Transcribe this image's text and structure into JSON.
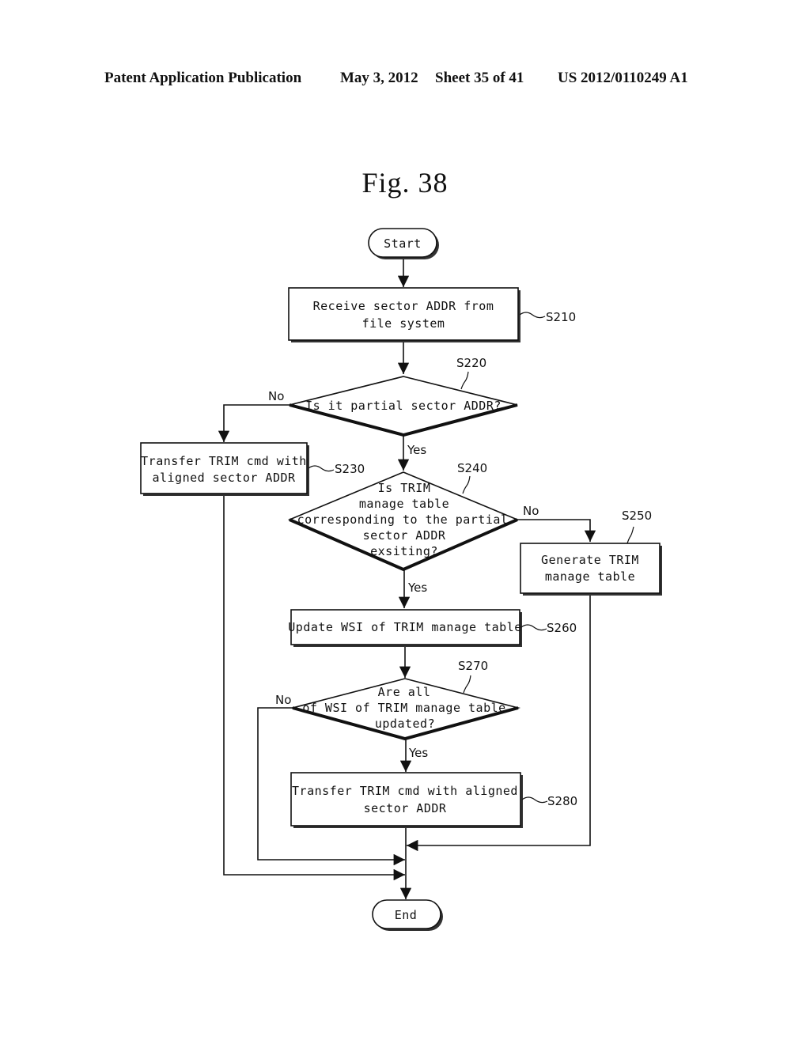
{
  "header": {
    "publication": "Patent Application Publication",
    "date": "May 3, 2012",
    "sheet": "Sheet 35 of 41",
    "number": "US 2012/0110249 A1"
  },
  "figure": {
    "title": "Fig. 38"
  },
  "nodes": {
    "start": {
      "text": "Start"
    },
    "s210": {
      "lines": [
        "Receive sector ADDR from",
        "file system"
      ],
      "ref": "S210"
    },
    "s220": {
      "lines": [
        "Is it partial sector ADDR?"
      ],
      "ref": "S220"
    },
    "s230": {
      "lines": [
        "Transfer TRIM cmd with",
        "aligned sector ADDR"
      ],
      "ref": "S230"
    },
    "s240": {
      "lines": [
        "Is TRIM",
        "manage table",
        "corresponding to the partial",
        "sector ADDR",
        "exsiting?"
      ],
      "ref": "S240"
    },
    "s250": {
      "lines": [
        "Generate TRIM",
        "manage table"
      ],
      "ref": "S250"
    },
    "s260": {
      "lines": [
        "Update WSI of TRIM manage table"
      ],
      "ref": "S260"
    },
    "s270": {
      "lines": [
        "Are all",
        "of WSI of TRIM manage table",
        "updated?"
      ],
      "ref": "S270"
    },
    "s280": {
      "lines": [
        "Transfer TRIM cmd with aligned",
        "sector ADDR"
      ],
      "ref": "S280"
    },
    "end": {
      "text": "End"
    }
  },
  "edge_labels": {
    "s220_no": "No",
    "s220_yes": "Yes",
    "s240_no": "No",
    "s240_yes": "Yes",
    "s270_no": "No",
    "s270_yes": "Yes"
  }
}
